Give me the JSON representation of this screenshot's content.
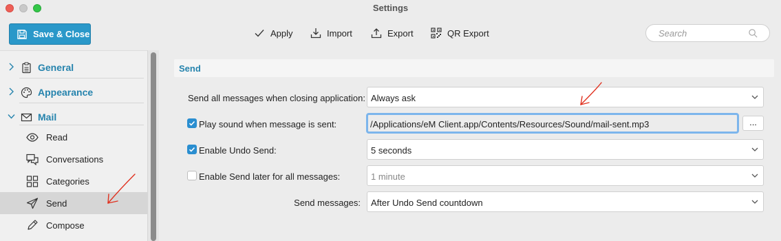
{
  "window": {
    "title": "Settings"
  },
  "toolbar": {
    "save_close": "Save & Close",
    "apply": "Apply",
    "import": "Import",
    "export": "Export",
    "qr_export": "QR Export",
    "search_placeholder": "Search"
  },
  "sidebar": {
    "sections": [
      {
        "label": "General",
        "icon": "clipboard-icon",
        "expanded": false
      },
      {
        "label": "Appearance",
        "icon": "palette-icon",
        "expanded": false
      },
      {
        "label": "Mail",
        "icon": "envelope-icon",
        "expanded": true
      }
    ],
    "mail_items": [
      {
        "label": "Read",
        "icon": "eye-icon"
      },
      {
        "label": "Conversations",
        "icon": "conversations-icon"
      },
      {
        "label": "Categories",
        "icon": "grid-icon"
      },
      {
        "label": "Send",
        "icon": "paper-plane-icon",
        "selected": true
      },
      {
        "label": "Compose",
        "icon": "pencil-icon"
      }
    ]
  },
  "send": {
    "header": "Send",
    "rows": [
      {
        "label": "Send all messages when closing application:",
        "value": "Always ask"
      },
      {
        "label": "Play sound when message is sent:",
        "checked": true,
        "value": "/Applications/eM Client.app/Contents/Resources/Sound/mail-sent.mp3",
        "browse": "..."
      },
      {
        "label": "Enable Undo Send:",
        "checked": true,
        "value": "5 seconds"
      },
      {
        "label": "Enable Send later for all messages:",
        "checked": false,
        "value": "1 minute",
        "disabled": true
      },
      {
        "label": "Send messages:",
        "value": "After Undo Send countdown"
      }
    ]
  },
  "colors": {
    "accent": "#2583ad",
    "button": "#2a98c9",
    "annotation": "#e0301e"
  }
}
